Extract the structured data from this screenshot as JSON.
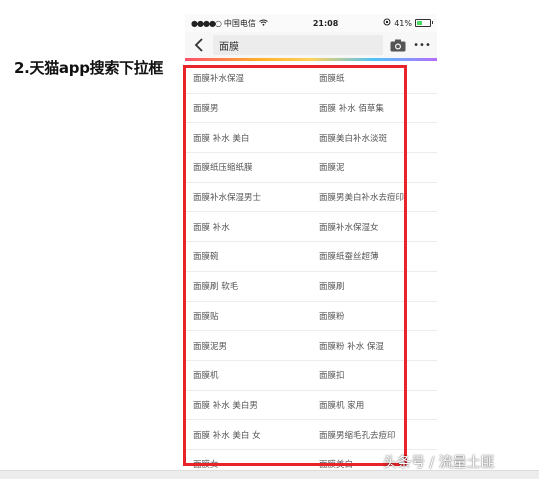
{
  "caption": "2.天猫app搜索下拉框",
  "status_bar": {
    "signal": "●●●●○",
    "carrier": "中国电信",
    "time": "21:08",
    "battery_percent": "41%"
  },
  "search": {
    "query": "面膜",
    "more": "•••"
  },
  "suggestions": [
    [
      "面膜补水保湿",
      "面膜纸"
    ],
    [
      "面膜男",
      "面膜 补水 佰草集"
    ],
    [
      "面膜 补水 美白",
      "面膜美白补水淡斑"
    ],
    [
      "面膜纸压缩纸膜",
      "面膜泥"
    ],
    [
      "面膜补水保湿男士",
      "面膜男美白补水去痘印"
    ],
    [
      "面膜 补水",
      "面膜补水保湿女"
    ],
    [
      "面膜碗",
      "面膜纸蚕丝超薄"
    ],
    [
      "面膜刷 软毛",
      "面膜刷"
    ],
    [
      "面膜贴",
      "面膜粉"
    ],
    [
      "面膜泥男",
      "面膜粉 补水 保湿"
    ],
    [
      "面膜机",
      "面膜扣"
    ],
    [
      "面膜 补水 美白男",
      "面膜机 家用"
    ],
    [
      "面膜 补水 美白 女",
      "面膜男缩毛孔去痘印"
    ],
    [
      "面膜女",
      "面膜美白"
    ]
  ],
  "watermark": "头条号 / 流量土匪",
  "colors": {
    "highlight": "#e8232a"
  }
}
